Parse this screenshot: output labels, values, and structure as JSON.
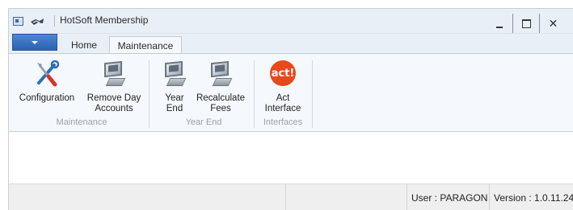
{
  "window": {
    "title": "HotSoft Membership"
  },
  "tabs": {
    "home": "Home",
    "maintenance": "Maintenance"
  },
  "ribbon": {
    "groups": [
      {
        "label": "Maintenance",
        "buttons": [
          {
            "label": "Configuration",
            "icon": "tools-icon"
          },
          {
            "label_line1": "Remove Day",
            "label_line2": "Accounts",
            "icon": "monitor-icon"
          }
        ]
      },
      {
        "label": "Year End",
        "buttons": [
          {
            "label_line1": "Year",
            "label_line2": "End",
            "icon": "monitor-icon"
          },
          {
            "label_line1": "Recalculate",
            "label_line2": "Fees",
            "icon": "monitor-icon"
          }
        ]
      },
      {
        "label": "Interfaces",
        "buttons": [
          {
            "label_line1": "Act",
            "label_line2": "Interface",
            "icon": "act-logo-icon",
            "logo_text": "act!"
          }
        ]
      }
    ]
  },
  "status": {
    "user": "User : PARAGON",
    "version": "Version : 1.0.11.24"
  },
  "colors": {
    "accent": "#2b62b3",
    "act_brand": "#e8481c"
  }
}
